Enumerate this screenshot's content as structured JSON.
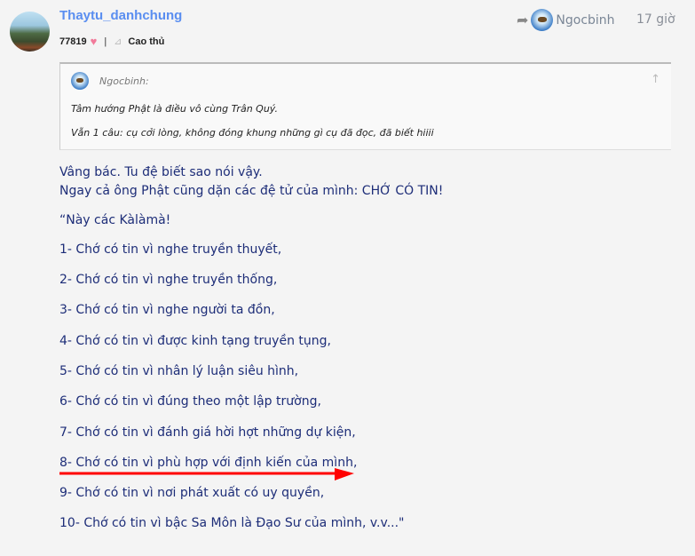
{
  "post": {
    "username": "Thaytu_danhchung",
    "points": "77819",
    "rank": "Cao thủ",
    "quoted_user": "Ngocbinh",
    "time": "17 giờ"
  },
  "quote": {
    "author": "Ngocbinh:",
    "lines": [
      "Tâm hướng Phật là điều vô cùng Trân Quý.",
      "Vẫn 1 câu: cụ cởi lòng, không đóng khung những gì cụ đã đọc, đã biết hiiii"
    ]
  },
  "content": {
    "intro": [
      "Vâng bác. Tu đệ biết sao nói vậy.",
      "Ngay cả ông Phật cũng dặn các đệ tử của mình: CHỚ CÓ TIN!"
    ],
    "opening": "“Này các Kàlàmà!",
    "items": [
      "1- Chớ có tin vì nghe truyền thuyết,",
      "2- Chớ có tin vì nghe truyền thống,",
      "3- Chớ có tin vì nghe người ta đồn,",
      "4- Chớ có tin vì được kinh tạng truyền tụng,",
      "5- Chớ có tin vì nhân lý luận siêu hình,",
      "6- Chớ có tin vì đúng theo một lập trường,",
      "7- Chớ có tin vì đánh giá hời hợt những dự kiện,",
      "8- Chớ có tin vì phù hợp với định kiến của mình,",
      "9- Chớ có tin vì nơi phát xuất có uy quyền,",
      "10- Chớ có tin vì bậc Sa Môn là Đạo Sư của mình, v.v...\""
    ]
  },
  "colors": {
    "username": "#5a8ef0",
    "body": "#1d2d78",
    "annotation": "#ff0000"
  }
}
